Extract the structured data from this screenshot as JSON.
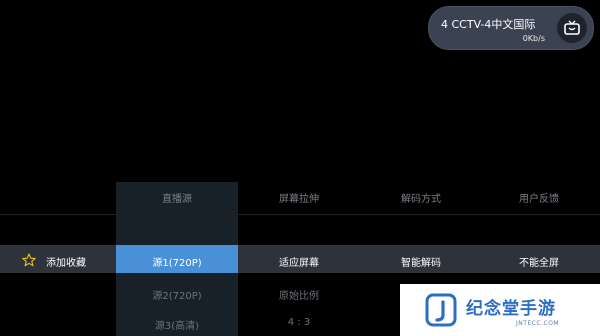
{
  "channel": {
    "title": "4  CCTV-4中文国际",
    "speed": "0Kb/s",
    "icon": "tv-icon"
  },
  "menu": {
    "headers": [
      "直播源",
      "屏幕拉伸",
      "解码方式",
      "用户反馈"
    ],
    "favorite": {
      "label": "添加收藏",
      "icon": "star-outline-icon"
    },
    "source": {
      "options": [
        "源1(720P)",
        "源2(720P)",
        "源3(高清)"
      ],
      "selected": "源1(720P)"
    },
    "screen_stretch": {
      "options": [
        "适应屏幕",
        "原始比例",
        "4 : 3"
      ],
      "selected": "适应屏幕"
    },
    "decode": {
      "selected": "智能解码"
    },
    "feedback": {
      "selected": "不能全屏"
    },
    "highlight_color": "#4a90d9"
  },
  "watermark": {
    "name": "纪念堂手游",
    "site": "JNTECC.COM"
  }
}
